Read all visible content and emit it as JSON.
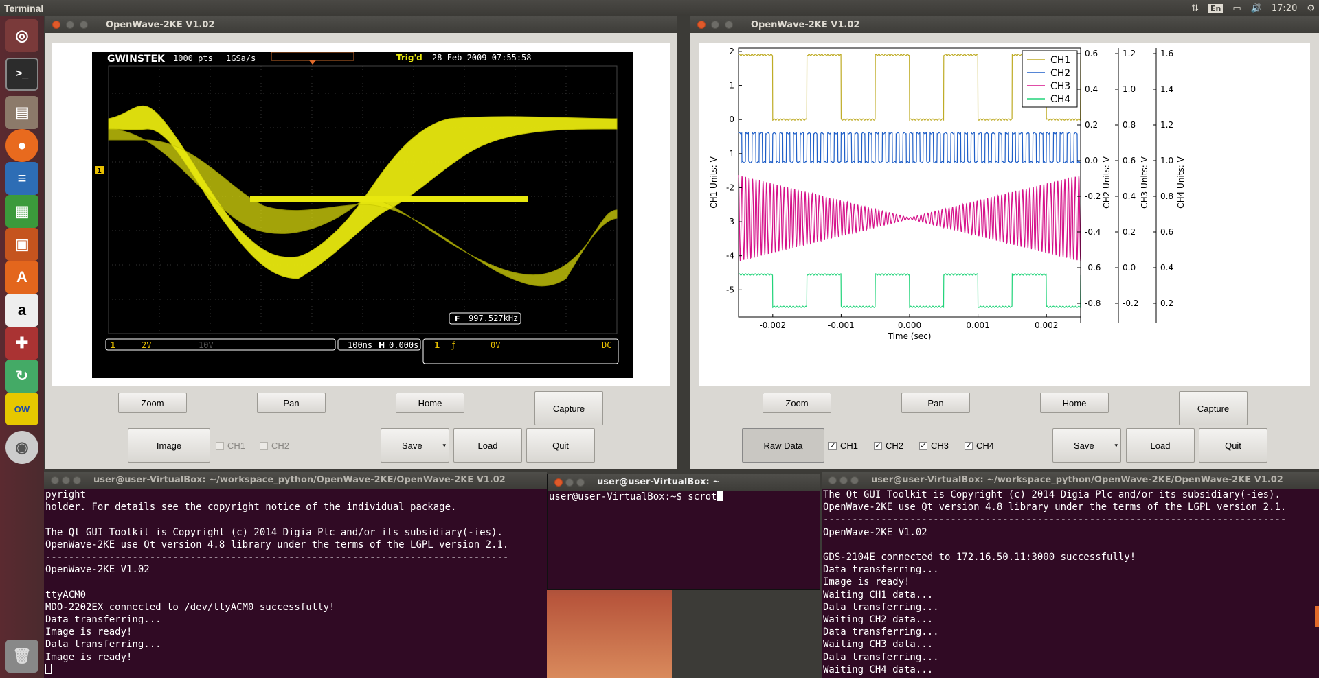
{
  "topbar": {
    "app_name": "Terminal",
    "lang": "En",
    "time": "17:20"
  },
  "launcher": {
    "items": [
      "ubuntu-dash",
      "terminal",
      "files",
      "firefox",
      "writer",
      "calc",
      "impress",
      "software-center",
      "amazon",
      "system-settings",
      "software-updater",
      "openwave",
      "dvd",
      "trash"
    ]
  },
  "left_window": {
    "title": "OpenWave-2KE V1.02",
    "scope_screen": {
      "brand": "GWINSTEK",
      "points": "1000 pts",
      "rate": "1GSa/s",
      "trig": "Trig'd",
      "datetime": "28 Feb 2009 07:55:58",
      "freq_label": "F",
      "freq": "997.527kHz",
      "ch1_marker": "1",
      "ch1_scale": "2V",
      "ch2_scale": "10V",
      "timebase": "100ns",
      "h_label": "H",
      "h_pos": "0.000s",
      "trig_src": "1",
      "trig_level": "0V",
      "coupling": "DC"
    },
    "buttons": {
      "zoom": "Zoom",
      "pan": "Pan",
      "home": "Home",
      "capture": "Capture",
      "image": "Image",
      "save": "Save",
      "load": "Load",
      "quit": "Quit"
    },
    "checks": [
      {
        "label": "CH1",
        "checked": false
      },
      {
        "label": "CH2",
        "checked": false
      }
    ]
  },
  "right_window": {
    "title": "OpenWave-2KE V1.02",
    "buttons": {
      "zoom": "Zoom",
      "pan": "Pan",
      "home": "Home",
      "capture": "Capture",
      "raw": "Raw Data",
      "save": "Save",
      "load": "Load",
      "quit": "Quit"
    },
    "checks": [
      {
        "label": "CH1",
        "checked": true
      },
      {
        "label": "CH2",
        "checked": true
      },
      {
        "label": "CH3",
        "checked": true
      },
      {
        "label": "CH4",
        "checked": true
      }
    ]
  },
  "chart_data": {
    "type": "line",
    "xlabel": "Time (sec)",
    "xlim": [
      -0.0025,
      0.0025
    ],
    "xticks": [
      "-0.002",
      "-0.001",
      "0.000",
      "0.001",
      "0.002"
    ],
    "y_axes": [
      {
        "label": "CH1 Units: V",
        "ticks": [
          "2",
          "1",
          "0",
          "-1",
          "-2",
          "-3",
          "-4",
          "-5"
        ],
        "ylim": [
          -5.8,
          2.1
        ]
      },
      {
        "label": "CH2 Units: V",
        "ticks": [
          "0.6",
          "0.4",
          "0.2",
          "0.0",
          "-0.2",
          "-0.4",
          "-0.6",
          "-0.8"
        ]
      },
      {
        "label": "CH3 Units: V",
        "ticks": [
          "1.2",
          "1.0",
          "0.8",
          "0.6",
          "0.4",
          "0.2",
          "0.0",
          "-0.2"
        ]
      },
      {
        "label": "CH4 Units: V",
        "ticks": [
          "1.6",
          "1.4",
          "1.2",
          "1.0",
          "0.8",
          "0.6",
          "0.4",
          "0.2"
        ]
      }
    ],
    "legend_position": "top-right",
    "series": [
      {
        "name": "CH1",
        "color": "#bfac26",
        "shape": "square wave",
        "low": 0.0,
        "high": 1.9,
        "period": 0.001
      },
      {
        "name": "CH2",
        "color": "#1f5fc8",
        "shape": "square wave",
        "low": -1.25,
        "high": -0.4,
        "period": 0.0001
      },
      {
        "name": "CH3",
        "color": "#d6128a",
        "shape": "amplitude-modulated sine",
        "center": -2.9,
        "max_amplitude": 1.25
      },
      {
        "name": "CH4",
        "color": "#22d47a",
        "shape": "square wave",
        "low": -5.5,
        "high": -4.55,
        "period": 0.001
      }
    ]
  },
  "terminals": {
    "left": {
      "title": "user@user-VirtualBox: ~/workspace_python/OpenWave-2KE/OpenWave-2KE V1.02",
      "lines": [
        "pyright",
        "holder. For details see the copyright notice of the individual package.",
        "",
        "The Qt GUI Toolkit is Copyright (c) 2014 Digia Plc and/or its subsidiary(-ies).",
        "OpenWave-2KE use Qt version 4.8 library under the terms of the LGPL version 2.1.",
        "--------------------------------------------------------------------------------",
        "OpenWave-2KE V1.02",
        "",
        "ttyACM0",
        "MDO-2202EX connected to /dev/ttyACM0 successfully!",
        "Data transferring...",
        "Image is ready!",
        "Data transferring...",
        "Image is ready!"
      ]
    },
    "middle": {
      "title": "user@user-VirtualBox: ~",
      "prompt": "user@user-VirtualBox:~$ ",
      "command": "scrot"
    },
    "right": {
      "title": "user@user-VirtualBox: ~/workspace_python/OpenWave-2KE/OpenWave-2KE V1.02",
      "lines": [
        "The Qt GUI Toolkit is Copyright (c) 2014 Digia Plc and/or its subsidiary(-ies).",
        "OpenWave-2KE use Qt version 4.8 library under the terms of the LGPL version 2.1.",
        "--------------------------------------------------------------------------------",
        "OpenWave-2KE V1.02",
        "",
        "GDS-2104E connected to 172.16.50.11:3000 successfully!",
        "Data transferring...",
        "Image is ready!",
        "Waiting CH1 data...",
        "Data transferring...",
        "Waiting CH2 data...",
        "Data transferring...",
        "Waiting CH3 data...",
        "Data transferring...",
        "Waiting CH4 data..."
      ]
    }
  }
}
